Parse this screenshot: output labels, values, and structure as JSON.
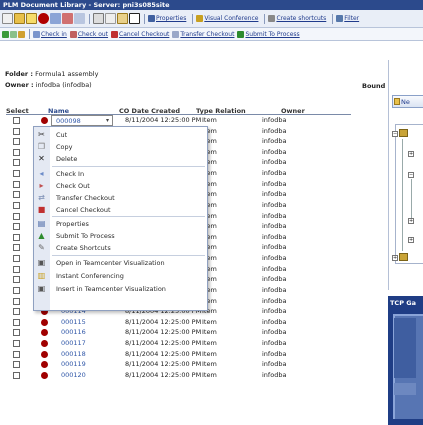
{
  "window": {
    "title": "PLM Document Library - Server: pni3s085site"
  },
  "toolbar1": {
    "properties": "Properties",
    "visual_conference": "Visual Conference",
    "create_shortcuts": "Create shortcuts",
    "filter": "Filter"
  },
  "toolbar2": {
    "check_in": "Check in",
    "check_out": "Check out",
    "cancel_checkout": "Cancel Checkout",
    "transfer_checkout": "Transfer Checkout",
    "submit_to_process": "Submit To Process"
  },
  "folder": {
    "label": "Folder :",
    "value": "Formula1 assembly"
  },
  "owner": {
    "label": "Owner :",
    "value": "infodba (infodba)"
  },
  "bound": "Bound 1",
  "table": {
    "headers": {
      "select": "Select",
      "name": "Name",
      "date": "CO Date Created",
      "type": "Type Relation",
      "owner": "Owner"
    },
    "first_row": {
      "name": "000098",
      "dropdown": "▾"
    },
    "rows": [
      {
        "date": "8/11/2004 12:25:00 PM",
        "type": "Item",
        "owner": "infodba"
      },
      {
        "date": "PM",
        "type": "Item",
        "owner": "infodba"
      },
      {
        "date": "PM",
        "type": "Item",
        "owner": "infodba"
      },
      {
        "date": "PM",
        "type": "Item",
        "owner": "infodba"
      },
      {
        "date": "PM",
        "type": "Item",
        "owner": "infodba"
      },
      {
        "date": "PM",
        "type": "Item",
        "owner": "infodba"
      },
      {
        "date": "PM",
        "type": "Item",
        "owner": "infodba"
      },
      {
        "date": "PM",
        "type": "Item",
        "owner": "infodba"
      },
      {
        "date": "PM",
        "type": "Item",
        "owner": "infodba"
      },
      {
        "date": "PM",
        "type": "Item",
        "owner": "infodba"
      },
      {
        "date": "PM",
        "type": "Item",
        "owner": "infodba"
      },
      {
        "date": "PM",
        "type": "Item",
        "owner": "infodba"
      },
      {
        "date": "PM",
        "type": "Item",
        "owner": "infodba"
      },
      {
        "date": "PM",
        "type": "Item",
        "owner": "infodba"
      },
      {
        "date": "PM",
        "type": "Item",
        "owner": "infodba"
      },
      {
        "date": "PM",
        "type": "Item",
        "owner": "infodba"
      },
      {
        "date": "PM",
        "type": "Item",
        "owner": "infodba"
      },
      {
        "name": "000113",
        "date": "8/11/2004 12:25:00 PM",
        "type": "Item",
        "owner": "infodba"
      },
      {
        "name": "000114",
        "date": "8/11/2004 12:25:00 PM",
        "type": "Item",
        "owner": "infodba"
      },
      {
        "name": "000115",
        "date": "8/11/2004 12:25:00 PM",
        "type": "Item",
        "owner": "infodba"
      },
      {
        "name": "000116",
        "date": "8/11/2004 12:25:00 PM",
        "type": "Item",
        "owner": "infodba"
      },
      {
        "name": "000117",
        "date": "8/11/2004 12:25:00 PM",
        "type": "Item",
        "owner": "infodba"
      },
      {
        "name": "000118",
        "date": "8/11/2004 12:25:00 PM",
        "type": "Item",
        "owner": "infodba"
      },
      {
        "name": "000119",
        "date": "8/11/2004 12:25:00 PM",
        "type": "Item",
        "owner": "infodba"
      },
      {
        "name": "000120",
        "date": "8/11/2004 12:25:00 PM",
        "type": "Item",
        "owner": "infodba"
      }
    ]
  },
  "context_menu": {
    "items": [
      {
        "label": "Cut",
        "icon": "cut-icon",
        "glyph": "✂",
        "color": "#333333"
      },
      {
        "label": "Copy",
        "icon": "copy-icon",
        "glyph": "❐",
        "color": "#777777"
      },
      {
        "label": "Delete",
        "icon": "delete-icon",
        "glyph": "✕",
        "color": "#222222"
      },
      {
        "label": "Check In",
        "icon": "check-in-icon",
        "glyph": "◂",
        "color": "#6c8cc8"
      },
      {
        "label": "Check Out",
        "icon": "check-out-icon",
        "glyph": "▸",
        "color": "#c05050"
      },
      {
        "label": "Transfer Checkout",
        "icon": "transfer-checkout-icon",
        "glyph": "⇄",
        "color": "#8899bb"
      },
      {
        "label": "Cancel Checkout",
        "icon": "cancel-checkout-icon",
        "glyph": "■",
        "color": "#c03030"
      },
      {
        "label": "Properties",
        "icon": "properties-icon",
        "glyph": "▤",
        "color": "#4060a0"
      },
      {
        "label": "Submit To Process",
        "icon": "submit-icon",
        "glyph": "▲",
        "color": "#2e8b2e"
      },
      {
        "label": "Create Shortcuts",
        "icon": "shortcut-icon",
        "glyph": "✎",
        "color": "#666666"
      },
      {
        "label": "Open in Teamcenter Visualization",
        "icon": "visualization-icon",
        "glyph": "▣",
        "color": "#555555"
      },
      {
        "label": "Instant Conferencing",
        "icon": "conference-icon",
        "glyph": "▥",
        "color": "#c8a020"
      },
      {
        "label": "Insert in Teamcenter Visualization",
        "icon": "insert-visualization-icon",
        "glyph": "▣",
        "color": "#555555"
      }
    ]
  },
  "right_panel": {
    "new_button": "Ne",
    "tcp_label": "TCP Ga"
  },
  "colors": {
    "title_bar": "#2c4a8c",
    "link": "#3057a8",
    "status_dot": "#a00000"
  }
}
